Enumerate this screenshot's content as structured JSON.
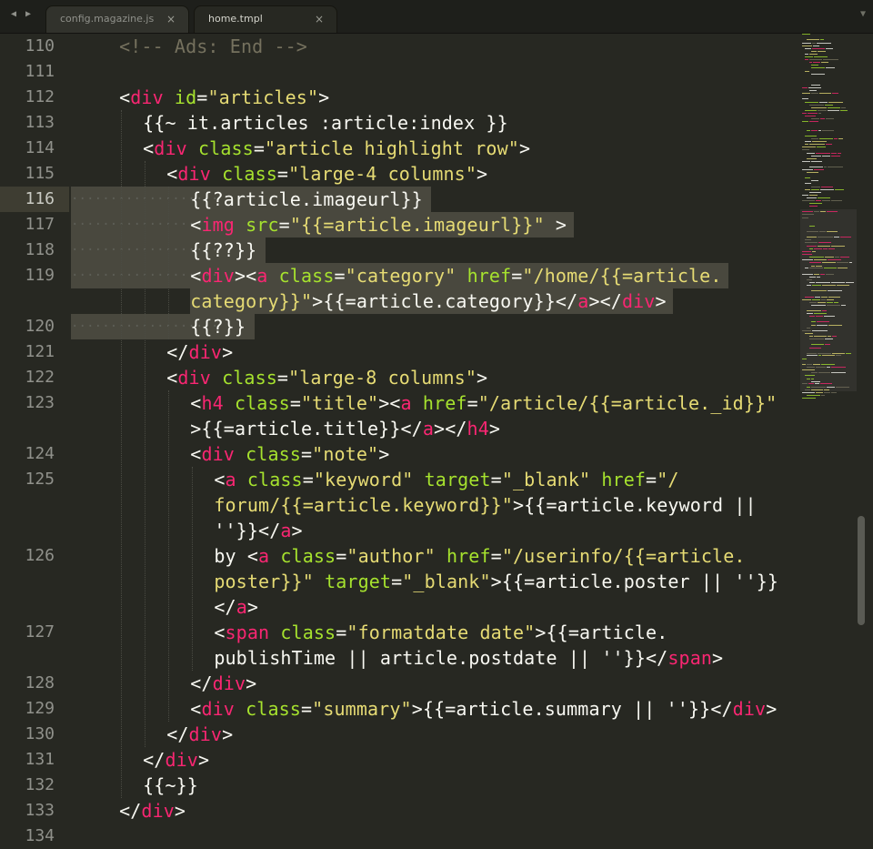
{
  "tabs": [
    {
      "label": "config.magazine.js",
      "close": "×"
    },
    {
      "label": "home.tmpl",
      "close": "×"
    }
  ],
  "nav": {
    "back": "◀",
    "forward": "▶",
    "tab_menu": "▼"
  },
  "editor": {
    "current_line": 116,
    "lines": [
      {
        "n": "110",
        "ind": 1,
        "rows": [
          [
            [
              "c",
              "<!-- Ads: End -->"
            ]
          ]
        ]
      },
      {
        "n": "111",
        "ind": 0,
        "rows": [
          []
        ]
      },
      {
        "n": "112",
        "ind": 1,
        "rows": [
          [
            [
              "p",
              "<"
            ],
            [
              "t",
              "div"
            ],
            [
              "p",
              " "
            ],
            [
              "a",
              "id"
            ],
            [
              "p",
              "="
            ],
            [
              "s",
              "\"articles\""
            ],
            [
              "p",
              ">"
            ]
          ]
        ]
      },
      {
        "n": "113",
        "ind": 2,
        "rows": [
          [
            [
              "p",
              "{{~ it.articles :article:index }}"
            ]
          ]
        ]
      },
      {
        "n": "114",
        "ind": 2,
        "rows": [
          [
            [
              "p",
              "<"
            ],
            [
              "t",
              "div"
            ],
            [
              "p",
              " "
            ],
            [
              "a",
              "class"
            ],
            [
              "p",
              "="
            ],
            [
              "s",
              "\"article highlight row\""
            ],
            [
              "p",
              ">"
            ]
          ]
        ]
      },
      {
        "n": "115",
        "ind": 3,
        "rows": [
          [
            [
              "p",
              "<"
            ],
            [
              "t",
              "div"
            ],
            [
              "p",
              " "
            ],
            [
              "a",
              "class"
            ],
            [
              "p",
              "="
            ],
            [
              "s",
              "\"large-4 columns\""
            ],
            [
              "p",
              ">"
            ]
          ]
        ]
      },
      {
        "n": "116",
        "ind": 4,
        "sel": true,
        "rows": [
          [
            [
              "p",
              "{{?article.imageurl}}"
            ]
          ]
        ]
      },
      {
        "n": "117",
        "ind": 4,
        "sel": true,
        "rows": [
          [
            [
              "p",
              "<"
            ],
            [
              "t",
              "img"
            ],
            [
              "p",
              " "
            ],
            [
              "a",
              "src"
            ],
            [
              "p",
              "="
            ],
            [
              "s",
              "\"{{=article.imageurl}}\""
            ],
            [
              "p",
              " >"
            ]
          ]
        ]
      },
      {
        "n": "118",
        "ind": 4,
        "sel": true,
        "rows": [
          [
            [
              "p",
              "{{??}}"
            ]
          ]
        ]
      },
      {
        "n": "119",
        "ind": 4,
        "sel": true,
        "rows": [
          [
            [
              "p",
              "<"
            ],
            [
              "t",
              "div"
            ],
            [
              "p",
              "><"
            ],
            [
              "t",
              "a"
            ],
            [
              "p",
              " "
            ],
            [
              "a",
              "class"
            ],
            [
              "p",
              "="
            ],
            [
              "s",
              "\"category\""
            ],
            [
              "p",
              " "
            ],
            [
              "a",
              "href"
            ],
            [
              "p",
              "="
            ],
            [
              "s",
              "\"/home/{{=article."
            ]
          ],
          [
            [
              "s",
              "category}}\""
            ],
            [
              "p",
              ">{{=article.category}}</"
            ],
            [
              "t",
              "a"
            ],
            [
              "p",
              "></"
            ],
            [
              "t",
              "div"
            ],
            [
              "p",
              ">"
            ]
          ]
        ]
      },
      {
        "n": "120",
        "ind": 4,
        "sel": true,
        "rows": [
          [
            [
              "p",
              "{{?}}"
            ]
          ]
        ]
      },
      {
        "n": "121",
        "ind": 3,
        "rows": [
          [
            [
              "p",
              "</"
            ],
            [
              "t",
              "div"
            ],
            [
              "p",
              ">"
            ]
          ]
        ]
      },
      {
        "n": "122",
        "ind": 3,
        "rows": [
          [
            [
              "p",
              "<"
            ],
            [
              "t",
              "div"
            ],
            [
              "p",
              " "
            ],
            [
              "a",
              "class"
            ],
            [
              "p",
              "="
            ],
            [
              "s",
              "\"large-8 columns\""
            ],
            [
              "p",
              ">"
            ]
          ]
        ]
      },
      {
        "n": "123",
        "ind": 4,
        "rows": [
          [
            [
              "p",
              "<"
            ],
            [
              "t",
              "h4"
            ],
            [
              "p",
              " "
            ],
            [
              "a",
              "class"
            ],
            [
              "p",
              "="
            ],
            [
              "s",
              "\"title\""
            ],
            [
              "p",
              "><"
            ],
            [
              "t",
              "a"
            ],
            [
              "p",
              " "
            ],
            [
              "a",
              "href"
            ],
            [
              "p",
              "="
            ],
            [
              "s",
              "\"/article/{{=article._id}}\""
            ]
          ],
          [
            [
              "p",
              ">{{=article.title}}</"
            ],
            [
              "t",
              "a"
            ],
            [
              "p",
              "></"
            ],
            [
              "t",
              "h4"
            ],
            [
              "p",
              ">"
            ]
          ]
        ]
      },
      {
        "n": "124",
        "ind": 4,
        "rows": [
          [
            [
              "p",
              "<"
            ],
            [
              "t",
              "div"
            ],
            [
              "p",
              " "
            ],
            [
              "a",
              "class"
            ],
            [
              "p",
              "="
            ],
            [
              "s",
              "\"note\""
            ],
            [
              "p",
              ">"
            ]
          ]
        ]
      },
      {
        "n": "125",
        "ind": 5,
        "rows": [
          [
            [
              "p",
              "<"
            ],
            [
              "t",
              "a"
            ],
            [
              "p",
              " "
            ],
            [
              "a",
              "class"
            ],
            [
              "p",
              "="
            ],
            [
              "s",
              "\"keyword\""
            ],
            [
              "p",
              " "
            ],
            [
              "a",
              "target"
            ],
            [
              "p",
              "="
            ],
            [
              "s",
              "\"_blank\""
            ],
            [
              "p",
              " "
            ],
            [
              "a",
              "href"
            ],
            [
              "p",
              "="
            ],
            [
              "s",
              "\"/"
            ]
          ],
          [
            [
              "s",
              "forum/{{=article.keyword}}\""
            ],
            [
              "p",
              ">{{=article.keyword ||"
            ]
          ],
          [
            [
              "p",
              "''}}</"
            ],
            [
              "t",
              "a"
            ],
            [
              "p",
              ">"
            ]
          ]
        ]
      },
      {
        "n": "126",
        "ind": 5,
        "rows": [
          [
            [
              "p",
              "by <"
            ],
            [
              "t",
              "a"
            ],
            [
              "p",
              " "
            ],
            [
              "a",
              "class"
            ],
            [
              "p",
              "="
            ],
            [
              "s",
              "\"author\""
            ],
            [
              "p",
              " "
            ],
            [
              "a",
              "href"
            ],
            [
              "p",
              "="
            ],
            [
              "s",
              "\"/userinfo/{{=article."
            ]
          ],
          [
            [
              "s",
              "poster}}\""
            ],
            [
              "p",
              " "
            ],
            [
              "a",
              "target"
            ],
            [
              "p",
              "="
            ],
            [
              "s",
              "\"_blank\""
            ],
            [
              "p",
              ">{{=article.poster || ''}}"
            ]
          ],
          [
            [
              "p",
              "</"
            ],
            [
              "t",
              "a"
            ],
            [
              "p",
              ">"
            ]
          ]
        ]
      },
      {
        "n": "127",
        "ind": 5,
        "rows": [
          [
            [
              "p",
              "<"
            ],
            [
              "t",
              "span"
            ],
            [
              "p",
              " "
            ],
            [
              "a",
              "class"
            ],
            [
              "p",
              "="
            ],
            [
              "s",
              "\"formatdate date\""
            ],
            [
              "p",
              ">{{=article."
            ]
          ],
          [
            [
              "p",
              "publishTime || article.postdate || ''}}</"
            ],
            [
              "t",
              "span"
            ],
            [
              "p",
              ">"
            ]
          ]
        ]
      },
      {
        "n": "128",
        "ind": 4,
        "rows": [
          [
            [
              "p",
              "</"
            ],
            [
              "t",
              "div"
            ],
            [
              "p",
              ">"
            ]
          ]
        ]
      },
      {
        "n": "129",
        "ind": 4,
        "rows": [
          [
            [
              "p",
              "<"
            ],
            [
              "t",
              "div"
            ],
            [
              "p",
              " "
            ],
            [
              "a",
              "class"
            ],
            [
              "p",
              "="
            ],
            [
              "s",
              "\"summary\""
            ],
            [
              "p",
              ">{{=article.summary || ''}}</"
            ],
            [
              "t",
              "div"
            ],
            [
              "p",
              ">"
            ]
          ]
        ]
      },
      {
        "n": "130",
        "ind": 3,
        "rows": [
          [
            [
              "p",
              "</"
            ],
            [
              "t",
              "div"
            ],
            [
              "p",
              ">"
            ]
          ]
        ]
      },
      {
        "n": "131",
        "ind": 2,
        "rows": [
          [
            [
              "p",
              "</"
            ],
            [
              "t",
              "div"
            ],
            [
              "p",
              ">"
            ]
          ]
        ]
      },
      {
        "n": "132",
        "ind": 2,
        "rows": [
          [
            [
              "p",
              "{{~}}"
            ]
          ]
        ]
      },
      {
        "n": "133",
        "ind": 1,
        "rows": [
          [
            [
              "p",
              "</"
            ],
            [
              "t",
              "div"
            ],
            [
              "p",
              ">"
            ]
          ]
        ]
      },
      {
        "n": "134",
        "ind": 0,
        "rows": [
          []
        ]
      }
    ]
  },
  "colors": {
    "background": "#272822",
    "text": "#f8f8f2",
    "tag": "#f92672",
    "attribute": "#a6e22e",
    "string": "#e6db74",
    "comment": "#75715e",
    "selection": "#49483e",
    "gutter_text": "#90918b"
  }
}
